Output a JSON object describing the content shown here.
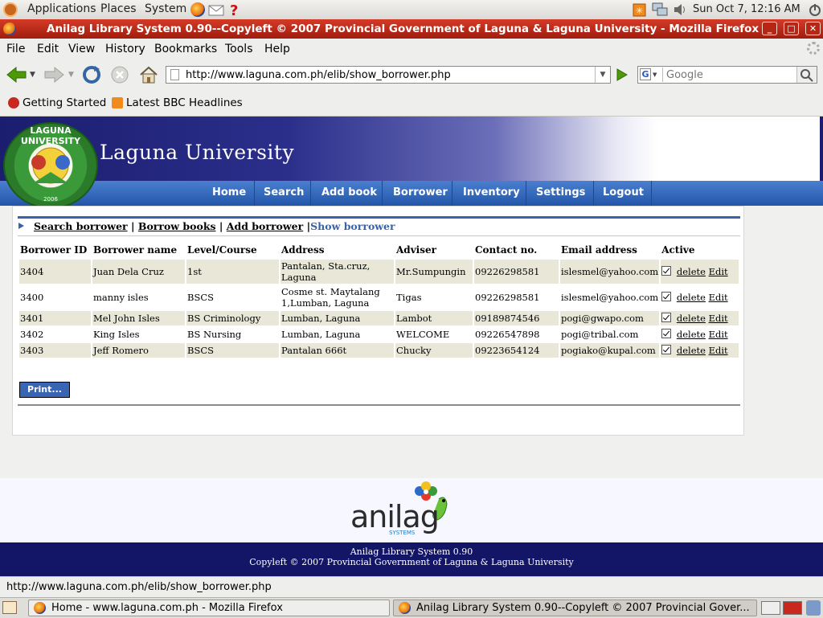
{
  "panel": {
    "menus": [
      "Applications",
      "Places",
      "System"
    ],
    "clock": "Sun Oct  7, 12:16 AM"
  },
  "window": {
    "title": "Anilag Library System 0.90--Copyleft © 2007 Provincial Government of Laguna & Laguna University - Mozilla Firefox",
    "buttons": [
      "_",
      "□",
      "✕"
    ]
  },
  "menubar": [
    "File",
    "Edit",
    "View",
    "History",
    "Bookmarks",
    "Tools",
    "Help"
  ],
  "navbar": {
    "url": "http://www.laguna.com.ph/elib/show_borrower.php",
    "search_placeholder": "Google"
  },
  "bookmarks": [
    "Getting Started",
    "Latest BBC Headlines"
  ],
  "site": {
    "title": "Laguna University",
    "logo_ring": "LAGUNA UNIVERSITY",
    "logo_year": "2006",
    "nav": [
      "Home",
      "Search",
      "Add book",
      "Borrower",
      "Inventory",
      "Settings",
      "Logout"
    ]
  },
  "subnav": {
    "links": [
      "Search borrower",
      "Borrow books",
      "Add borrower"
    ],
    "current": "Show borrower"
  },
  "table": {
    "headers": [
      "Borrower ID",
      "Borrower name",
      "Level/Course",
      "Address",
      "Adviser",
      "Contact no.",
      "Email address",
      "Active"
    ],
    "rows": [
      {
        "id": "3404",
        "name": "Juan Dela Cruz",
        "course": "1st",
        "address": "Pantalan, Sta.cruz, Laguna",
        "adviser": "Mr.Sumpungin",
        "contact": "09226298581",
        "email": "islesmel@yahoo.com"
      },
      {
        "id": "3400",
        "name": "manny isles",
        "course": "BSCS",
        "address": "Cosme st. Maytalang 1,Lumban, Laguna",
        "adviser": "Tigas",
        "contact": "09226298581",
        "email": "islesmel@yahoo.com"
      },
      {
        "id": "3401",
        "name": "Mel John Isles",
        "course": "BS Criminology",
        "address": "Lumban, Laguna",
        "adviser": "Lambot",
        "contact": "09189874546",
        "email": "pogi@gwapo.com"
      },
      {
        "id": "3402",
        "name": "King Isles",
        "course": "BS Nursing",
        "address": "Lumban, Laguna",
        "adviser": "WELCOME",
        "contact": "09226547898",
        "email": "pogi@tribal.com"
      },
      {
        "id": "3403",
        "name": "Jeff Romero",
        "course": "BSCS",
        "address": "Pantalan 666t",
        "adviser": "Chucky",
        "contact": "09223654124",
        "email": "pogiako@kupal.com"
      }
    ],
    "delete_label": "delete",
    "edit_label": "Edit"
  },
  "print_label": "Print...",
  "footer": {
    "brand": "anilag",
    "brand_sub": "SYSTEMS",
    "line1": "Anilag Library System 0.90",
    "line2": "Copyleft © 2007 Provincial Government of Laguna & Laguna University"
  },
  "statusbar": "http://www.laguna.com.ph/elib/show_borrower.php",
  "taskbar": [
    "Home - www.laguna.com.ph - Mozilla Firefox",
    "Anilag Library System 0.90--Copyleft © 2007 Provincial Gover..."
  ],
  "colors": {
    "titlebar": "#b82b17",
    "nav_blue": "#2e63b5",
    "link_blue": "#3a62a8",
    "footer_navy": "#131566",
    "row_shade": "#e9e8d8"
  }
}
